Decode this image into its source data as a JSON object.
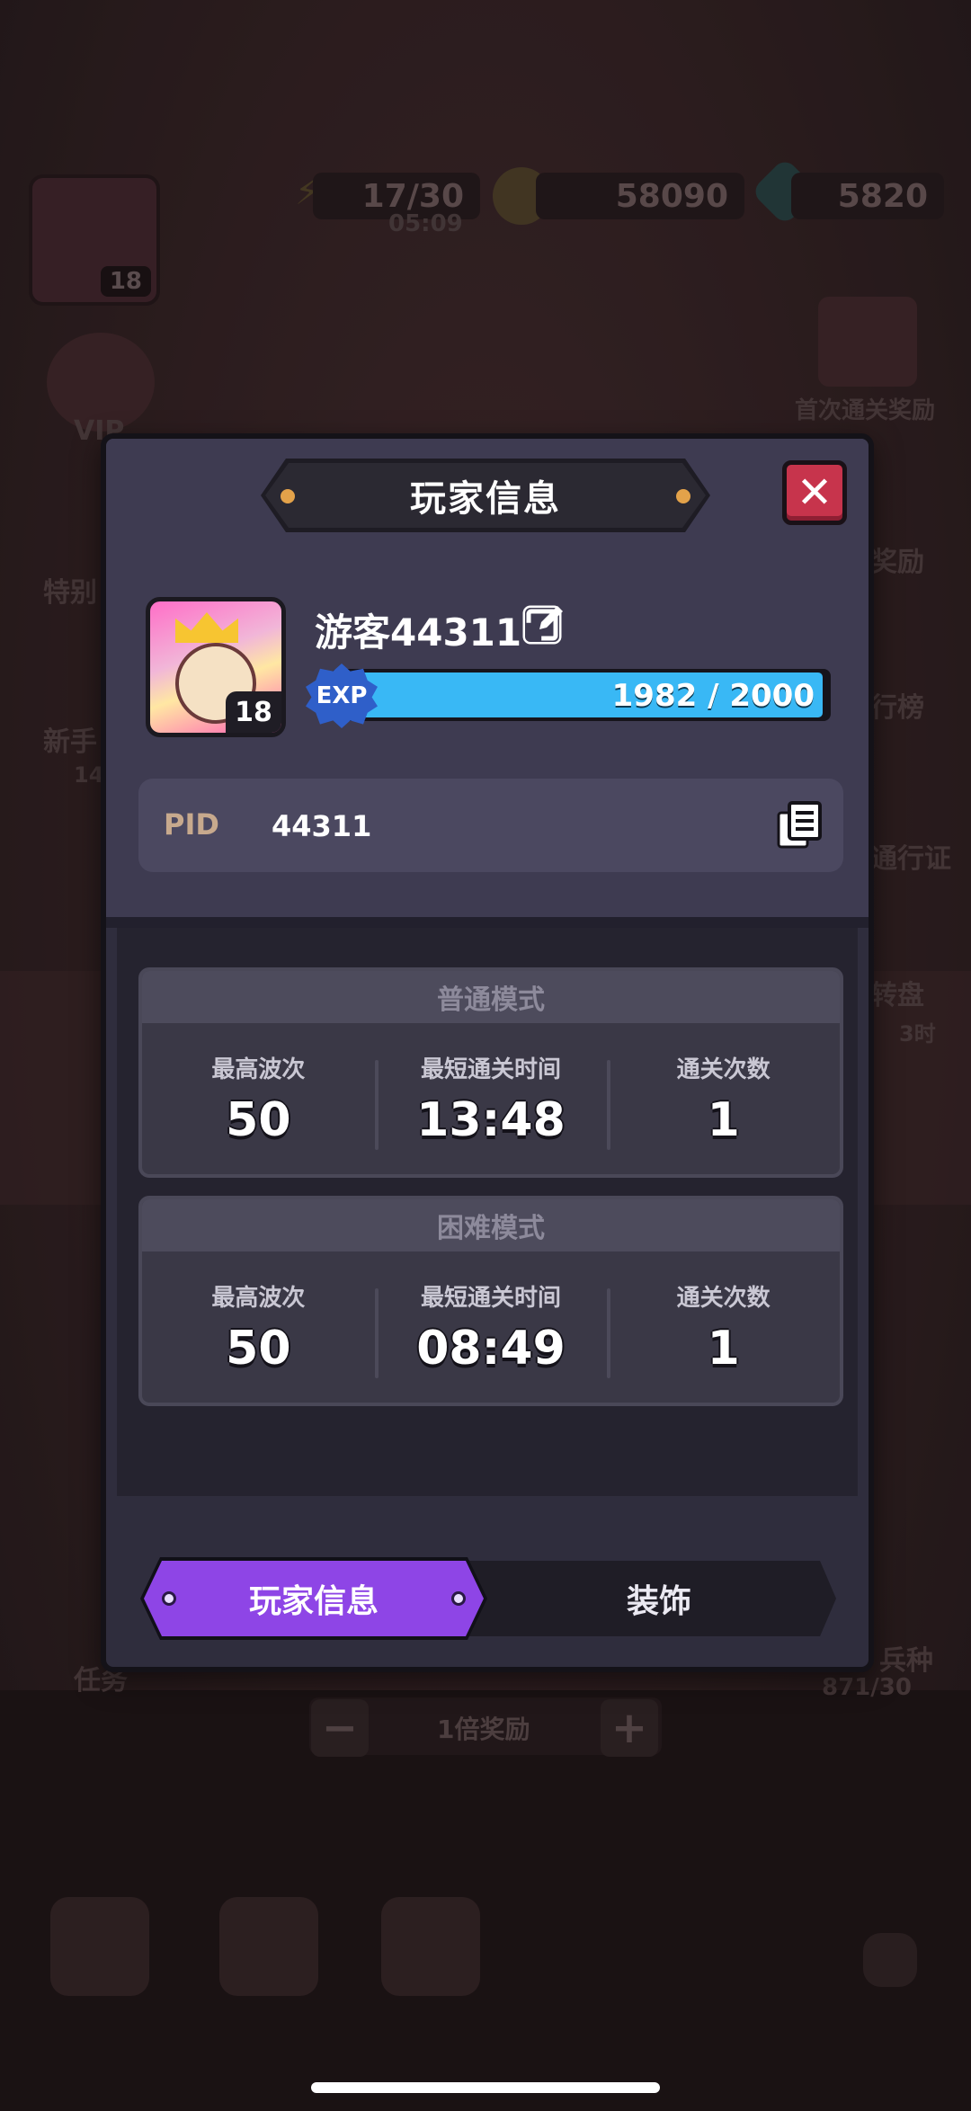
{
  "background": {
    "energy": "17/30",
    "energy_timer": "05:09",
    "gold": "58090",
    "gems": "5820",
    "player_level_small": "18",
    "first_clear_reward": "首次通关奖励",
    "side_left_1": "特别",
    "side_left_2": "新手",
    "side_left_counter": "14",
    "side_right_1": "奖励",
    "side_right_2": "行榜",
    "side_right_3": "通行证",
    "side_right_4": "转盘",
    "side_right_4_sub": "3时",
    "vip_label": "VIP",
    "task_label": "任务",
    "troops_label": "兵种",
    "troops_count": "871/30",
    "reward_multiplier": "1倍奖励",
    "minus": "−",
    "plus": "+"
  },
  "dialog": {
    "title": "玩家信息",
    "close_symbol": "✕",
    "player": {
      "name": "游客44311",
      "level": "18",
      "exp_label": "EXP",
      "exp_text": "1982 / 2000",
      "exp_current": 1982,
      "exp_max": 2000
    },
    "pid": {
      "label": "PID",
      "value": "44311"
    },
    "modes": [
      {
        "title": "普通模式",
        "stats": [
          {
            "label": "最高波次",
            "value": "50"
          },
          {
            "label": "最短通关时间",
            "value": "13:48"
          },
          {
            "label": "通关次数",
            "value": "1"
          }
        ]
      },
      {
        "title": "困难模式",
        "stats": [
          {
            "label": "最高波次",
            "value": "50"
          },
          {
            "label": "最短通关时间",
            "value": "08:49"
          },
          {
            "label": "通关次数",
            "value": "1"
          }
        ]
      }
    ],
    "tabs": [
      {
        "label": "玩家信息",
        "active": true
      },
      {
        "label": "装饰",
        "active": false
      }
    ]
  },
  "colors": {
    "accent_purple": "#8e45e6",
    "exp_blue": "#39b8f5",
    "close_red": "#c7344c",
    "pid_label": "#c7a98d"
  }
}
